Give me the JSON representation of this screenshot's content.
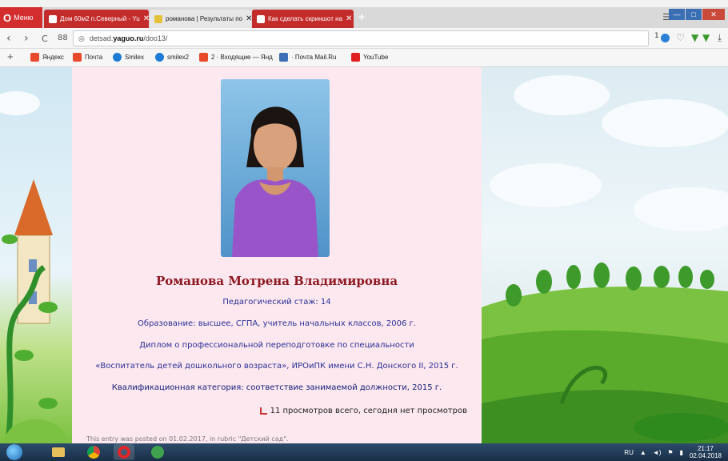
{
  "browser": {
    "menu_label": "Меню",
    "tabs": [
      {
        "title": "Дом 60м2 п.Северный - Yu"
      },
      {
        "title": "романова | Результаты по"
      },
      {
        "title": "Как сделать скриншот на"
      }
    ],
    "new_tab": "+",
    "tab_menu": "☰",
    "window_controls": {
      "minimize": "—",
      "maximize": "□",
      "close": "✕"
    }
  },
  "address_bar": {
    "back": "‹",
    "forward": "›",
    "reload": "C",
    "speed_dial": "88",
    "url_prefix": "detsad.",
    "url_host": "yaguo.ru",
    "url_path": "/doo13/",
    "badge_count": "1",
    "heart": "♡",
    "download": "⤓"
  },
  "bookmarks": {
    "add": "+",
    "items": [
      {
        "label": "Яндекс",
        "color": "#e8492b"
      },
      {
        "label": "Почта",
        "color": "#e8492b"
      },
      {
        "label": "Smilex",
        "color": "#1e7bd6"
      },
      {
        "label": "smilex2",
        "color": "#1e7bd6"
      },
      {
        "label": "2 · Входящие — Янд",
        "color": "#e8492b"
      },
      {
        "label": "· Почта Mail.Ru",
        "color": "#3d6fb6"
      },
      {
        "label": "YouTube",
        "color": "#e02020"
      }
    ]
  },
  "page": {
    "name": "Романова Мотрена Владимировна",
    "experience": "Педагогический стаж: 14",
    "education": "Образование: высшее, СГПА, учитель начальных классов, 2006 г.",
    "diploma_1": "Диплом о профессиональной переподготовке по специальности",
    "diploma_2": "«Воспитатель детей дошкольного возраста», ИРОиПК имени С.Н. Донского II, 2015 г.",
    "category": "Квалификационная категория: соответствие занимаемой должности, 2015 г.",
    "views": "11 просмотров всего, сегодня нет просмотров",
    "footnote": "This entry was posted on 01.02.2017, in rubric \"Детский сад\"."
  },
  "taskbar": {
    "apps": [
      "start-button",
      "file-explorer",
      "chrome",
      "opera",
      "utorrent"
    ],
    "lang": "RU",
    "time": "21:17",
    "date": "02.04.2018"
  },
  "colors": {
    "tab_red": "#c42b2b",
    "page_bg": "#fce8ee",
    "name_color": "#8e1822",
    "text_blue": "#2a2f9a"
  }
}
